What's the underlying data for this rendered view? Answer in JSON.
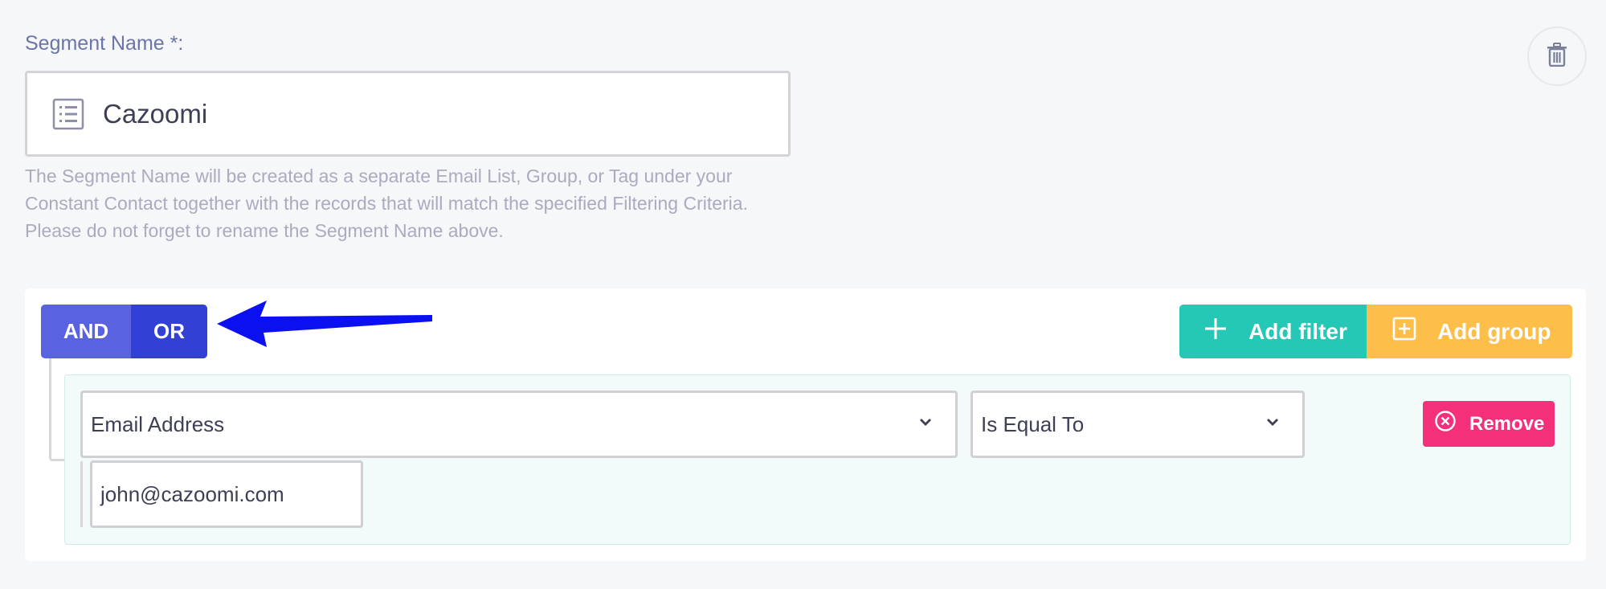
{
  "segment": {
    "label": "Segment Name *:",
    "name_value": "Cazoomi",
    "helper_text": "The Segment Name will be created as a separate Email List, Group, or Tag under your Constant Contact together with the records that will match the specified Filtering Criteria. Please do not forget to rename the Segment Name above."
  },
  "logic": {
    "and_label": "AND",
    "or_label": "OR",
    "selected": "OR"
  },
  "actions": {
    "add_filter_label": "Add filter",
    "add_group_label": "Add group"
  },
  "filter": {
    "field_value": "Email Address",
    "operator_value": "Is Equal To",
    "input_value": "john@cazoomi.com",
    "remove_label": "Remove"
  },
  "icons": {
    "trash": "trash-icon",
    "list": "list-icon",
    "arrow": "arrow-left-annotation",
    "plus": "plus-icon",
    "plus_square": "plus-square-icon",
    "chevron": "chevron-down-icon",
    "remove": "x-circle-icon"
  },
  "colors": {
    "and": "#5a63df",
    "or": "#3340d6",
    "add_filter": "#25c8b4",
    "add_group": "#fdbe4a",
    "remove": "#f5307a",
    "annotation_arrow": "#0a10f0"
  }
}
